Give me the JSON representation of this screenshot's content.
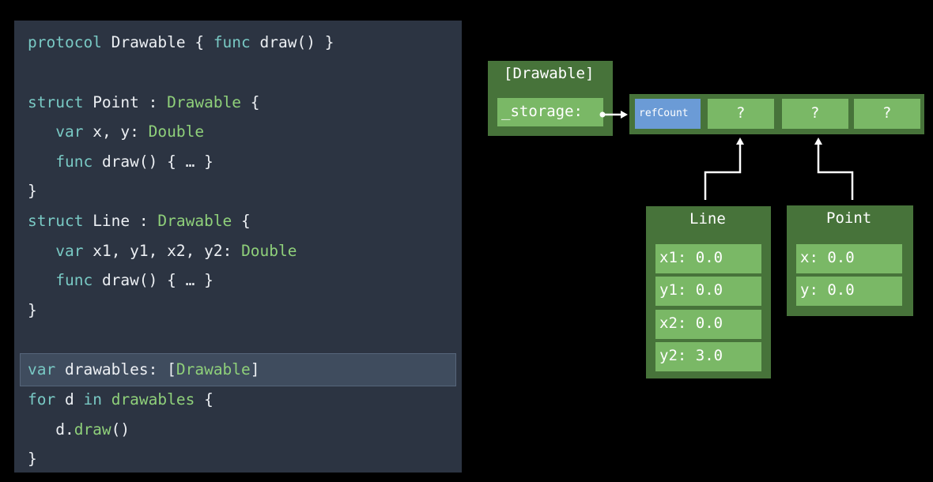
{
  "colors": {
    "panel_bg": "#2c3442",
    "highlight_bg": "#3f4c5e",
    "plain_text": "#eceff3",
    "keyword": "#79c9c4",
    "type_name": "#8fd07a",
    "outer_box": "#47733a",
    "inner_box": "#7ab866",
    "refcount_box": "#6b9bd6"
  },
  "code": {
    "lines": [
      [
        {
          "t": "protocol",
          "k": "keyword"
        },
        {
          "t": " Drawable { ",
          "k": "plain"
        },
        {
          "t": "func",
          "k": "keyword"
        },
        {
          "t": " draw() }",
          "k": "plain"
        }
      ],
      [],
      [
        {
          "t": "struct",
          "k": "keyword"
        },
        {
          "t": " Point : ",
          "k": "plain"
        },
        {
          "t": "Drawable",
          "k": "type"
        },
        {
          "t": " {",
          "k": "plain"
        }
      ],
      [
        {
          "t": "   ",
          "k": "plain"
        },
        {
          "t": "var",
          "k": "keyword"
        },
        {
          "t": " x, y: ",
          "k": "plain"
        },
        {
          "t": "Double",
          "k": "type"
        }
      ],
      [
        {
          "t": "   ",
          "k": "plain"
        },
        {
          "t": "func",
          "k": "keyword"
        },
        {
          "t": " draw() { … }",
          "k": "plain"
        }
      ],
      [
        {
          "t": "}",
          "k": "plain"
        }
      ],
      [
        {
          "t": "struct",
          "k": "keyword"
        },
        {
          "t": " Line : ",
          "k": "plain"
        },
        {
          "t": "Drawable",
          "k": "type"
        },
        {
          "t": " {",
          "k": "plain"
        }
      ],
      [
        {
          "t": "   ",
          "k": "plain"
        },
        {
          "t": "var",
          "k": "keyword"
        },
        {
          "t": " x1, y1, x2, y2: ",
          "k": "plain"
        },
        {
          "t": "Double",
          "k": "type"
        }
      ],
      [
        {
          "t": "   ",
          "k": "plain"
        },
        {
          "t": "func",
          "k": "keyword"
        },
        {
          "t": " draw() { … }",
          "k": "plain"
        }
      ],
      [
        {
          "t": "}",
          "k": "plain"
        }
      ],
      [],
      [
        {
          "t": "var",
          "k": "keyword"
        },
        {
          "t": " drawables: [",
          "k": "plain"
        },
        {
          "t": "Drawable",
          "k": "type"
        },
        {
          "t": "]",
          "k": "plain"
        }
      ],
      [
        {
          "t": "for",
          "k": "keyword"
        },
        {
          "t": " d ",
          "k": "plain"
        },
        {
          "t": "in",
          "k": "keyword"
        },
        {
          "t": " ",
          "k": "plain"
        },
        {
          "t": "drawables",
          "k": "type"
        },
        {
          "t": " {",
          "k": "plain"
        }
      ],
      [
        {
          "t": "   d.",
          "k": "plain"
        },
        {
          "t": "draw",
          "k": "type"
        },
        {
          "t": "()",
          "k": "plain"
        }
      ],
      [
        {
          "t": "}",
          "k": "plain"
        }
      ]
    ],
    "highlighted_line_index": 11
  },
  "diagram": {
    "array_box": {
      "title": "[Drawable]",
      "storage_label": "_storage:"
    },
    "storage_cells": [
      "refCount",
      "?",
      "?",
      "?"
    ],
    "line_box": {
      "title": "Line",
      "fields": [
        "x1: 0.0",
        "y1: 0.0",
        "x2: 0.0",
        "y2: 3.0"
      ]
    },
    "point_box": {
      "title": "Point",
      "fields": [
        "x: 0.0",
        "y: 0.0"
      ]
    }
  }
}
